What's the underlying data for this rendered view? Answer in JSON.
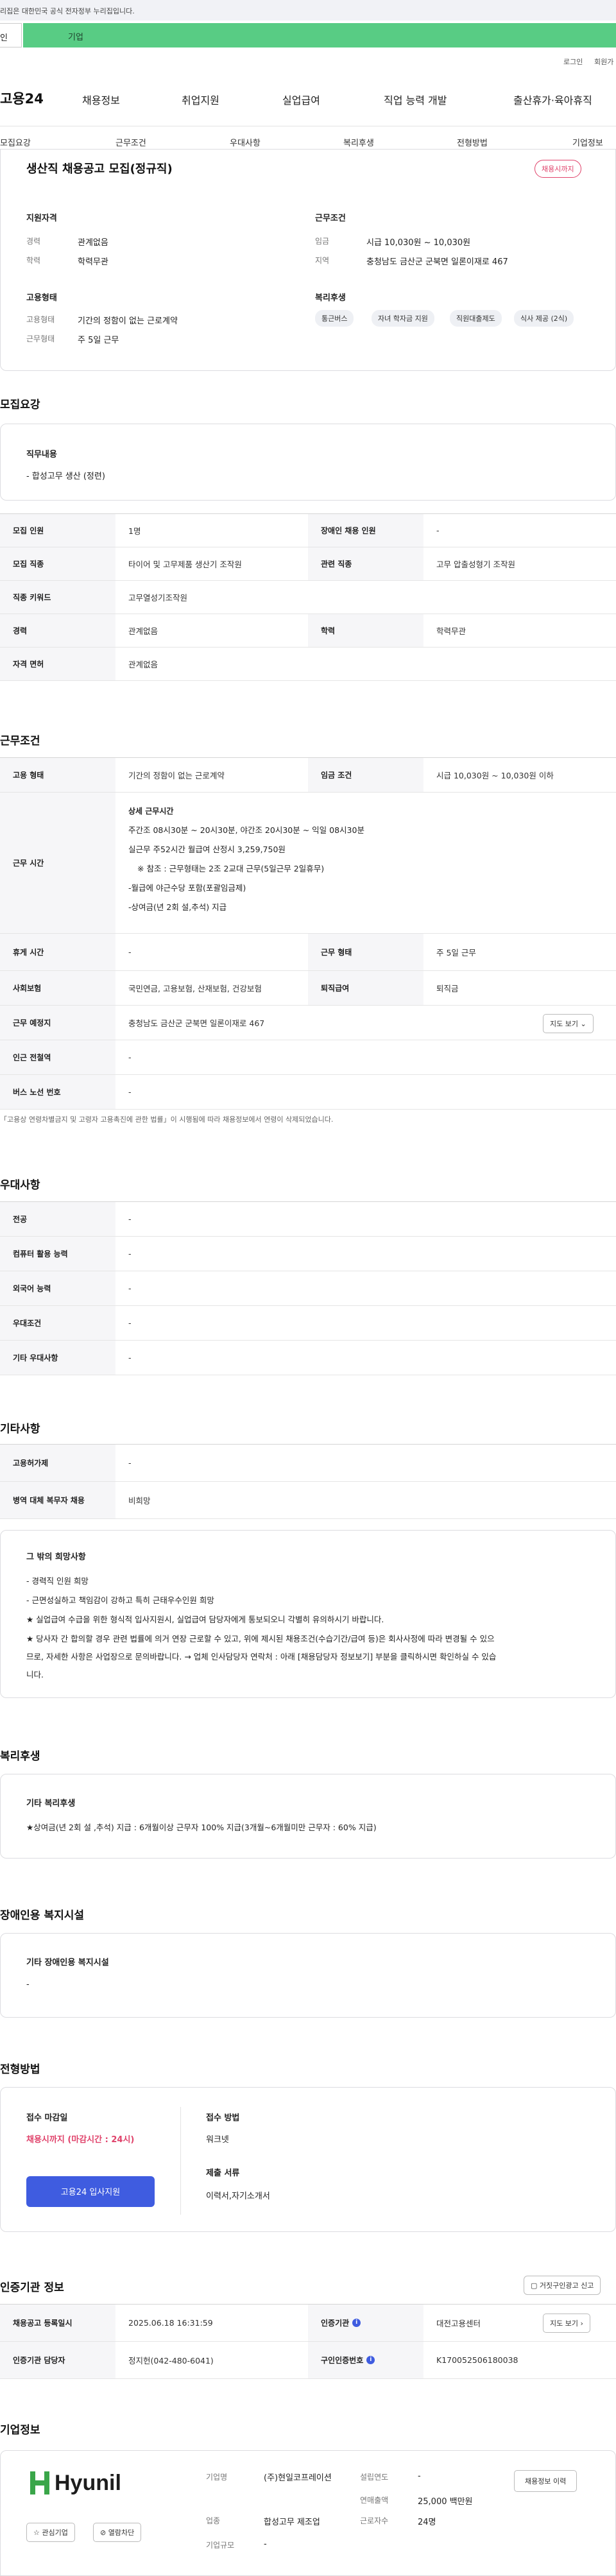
{
  "gov_notice": "리집은 대한민국 공식 전자정부 누리집입니다.",
  "top_tabs": {
    "person": "인",
    "company": "기업"
  },
  "util_links": {
    "login": "로그인",
    "signup": "회원가"
  },
  "gnb": {
    "logo": "고용24",
    "menus": [
      "채용정보",
      "취업지원",
      "실업급여",
      "직업 능력 개발",
      "출산휴가·육아휴직"
    ]
  },
  "subnav": [
    "모집요강",
    "근무조건",
    "우대사항",
    "복리후생",
    "전형방법",
    "기업정보"
  ],
  "summary": {
    "title": "생산직 채용공고 모집(정규직)",
    "badge": "채용시까지",
    "qual_title": "지원자격",
    "qual": [
      [
        "경력",
        "관계없음"
      ],
      [
        "학력",
        "학력무관"
      ]
    ],
    "cond_title": "근무조건",
    "cond": [
      [
        "임금",
        "시급 10,030원 ~ 10,030원"
      ],
      [
        "지역",
        "충청남도 금산군 군북면 일론이재로 467"
      ]
    ],
    "emp_title": "고용형태",
    "emp": [
      [
        "고용형태",
        "기간의 정함이 없는 근로계약"
      ],
      [
        "근무형태",
        "주 5일 근무"
      ]
    ],
    "welfare_title": "복리후생",
    "welfare_chips": [
      "통근버스",
      "자녀 학자금 지원",
      "직원대출제도",
      "식사 제공 (2식)"
    ]
  },
  "recruit": {
    "section": "모집요강",
    "duty_title": "직무내용",
    "duty_text": "- 합성고무  생산 (정련)",
    "rows": [
      [
        "모집 인원",
        "1명",
        "장애인 채용 인원",
        "-"
      ],
      [
        "모집 직종",
        "타이어 및 고무제품 생산기 조작원",
        "관련 직종",
        "고무 압출성형기 조작원"
      ],
      [
        "직종 키워드",
        "고무열성기조작원",
        "",
        ""
      ],
      [
        "경력",
        "관계없음",
        "학력",
        "학력무관"
      ],
      [
        "자격 면허",
        "관계없음",
        "",
        ""
      ]
    ]
  },
  "work": {
    "section": "근무조건",
    "emp_type_label": "고용 형태",
    "emp_type_value": "기간의 정함이 없는 근로계약",
    "wage_label": "임금 조건",
    "wage_value": "시급 10,030원 ~ 10,030원 이하",
    "hours_label": "근무 시간",
    "hours_lines": [
      "상세 근무시간",
      "주간조 08시30분 ~ 20시30분, 야간조 20시30분 ~ 익일 08시30분",
      "실근무 주52시간 월급여 산정시 3,259,750원",
      "※ 참조 : 근무형태는 2조 2교대 근무(5일근무 2일휴무)",
      "-월급에 야근수당 포함(포괄임금제)",
      "-상여금(년 2회 설,추석) 지급"
    ],
    "rest_label": "휴게 시간",
    "rest_value": "-",
    "worktype_label": "근무 형태",
    "worktype_value": "주 5일 근무",
    "ins_label": "사회보험",
    "ins_value": "국민연금, 고용보험, 산재보험, 건강보험",
    "retire_label": "퇴직급여",
    "retire_value": "퇴직금",
    "place_label": "근무 예정지",
    "place_value": "충청남도 금산군 군북면 일론이재로 467",
    "map_btn": "지도 보기",
    "station_label": "인근 전철역",
    "station_value": "-",
    "bus_label": "버스 노선 번호",
    "bus_value": "-",
    "note": "「고용상 연령차별금지 및 고령자 고용촉진에 관한 법률」이 시행됨에 따라 채용정보에서 연령이 삭제되었습니다."
  },
  "prefer": {
    "section": "우대사항",
    "rows": [
      [
        "전공",
        "-"
      ],
      [
        "컴퓨터 활용 능력",
        "-"
      ],
      [
        "외국어 능력",
        "-"
      ],
      [
        "우대조건",
        "-"
      ],
      [
        "기타 우대사항",
        "-"
      ]
    ]
  },
  "etc": {
    "section": "기타사항",
    "rows": [
      [
        "고용허가제",
        "-"
      ],
      [
        "병역 대체 복무자 채용",
        "비희망"
      ]
    ],
    "hope_title": "그 밖의 희망사항",
    "hope_lines": [
      "- 경력직 인원 희망",
      "- 근면성실하고 책임감이 강하고 특히 근태우수인원 희망",
      "★ 실업급여 수급을 위한 형식적 입사지원시, 실업급여 담당자에게 통보되오니 각별히 유의하시기 바랍니다.",
      "★ 당사자 간 합의할 경우 관련 법률에 의거 연장 근로할 수 있고, 위에 제시된 채용조건(수습기간/급여 등)은 회사사정에 따라 변경될 수 있으",
      "므로, 자세한 사항은 사업장으로 문의바랍니다. → 업체 인사담당자 연락처 : 아래 [채용담당자 정보보기] 부분을 클릭하시면 확인하실 수 있습",
      "니다."
    ]
  },
  "welfare": {
    "section": "복리후생",
    "title": "기타 복리후생",
    "text": "★상여금(년 2회 설 ,추석) 지급 : 6개월이상 근무자 100% 지급(3개월~6개월미만 근무자 : 60% 지급)"
  },
  "disabled": {
    "section": "장애인용 복지시설",
    "title": "기타 장애인용 복지시설",
    "text": "-"
  },
  "apply": {
    "section": "전형방법",
    "deadline_label": "접수 마감일",
    "deadline_value": "채용시까지 (마감시간 : 24시)",
    "apply_btn": "고용24 입사지원",
    "method_label": "접수 방법",
    "method_value": "워크넷",
    "docs_label": "제출 서류",
    "docs_value": "이력서,자기소개서"
  },
  "cert": {
    "section": "인증기관 정보",
    "report_btn": "거짓구인광고 신고",
    "r1_k1": "채용공고 등록일시",
    "r1_v1": "2025.06.18 16:31:59",
    "r1_k2": "인증기관",
    "r1_v2": "대전고용센터",
    "map_btn": "지도 보기",
    "r2_k1": "인증기관 담당자",
    "r2_v1": "정지헌(042-480-6041)",
    "r2_k2": "구인인증번호",
    "r2_v2": "K170052506180038"
  },
  "company": {
    "section": "기업정보",
    "logo": "Hyunil",
    "interest_btn": "관심기업",
    "block_btn": "열람차단",
    "name_label": "기업명",
    "name_value": "(주)현일코프레이션",
    "industry_label": "업종",
    "industry_value": "합성고무 제조업",
    "size_label": "기업규모",
    "size_value": "-",
    "founded_label": "설립연도",
    "founded_value": "-",
    "sales_label": "연매출액",
    "sales_value": "25,000 백만원",
    "employees_label": "근로자수",
    "employees_value": "24명",
    "history_btn": "채용정보 이력"
  }
}
